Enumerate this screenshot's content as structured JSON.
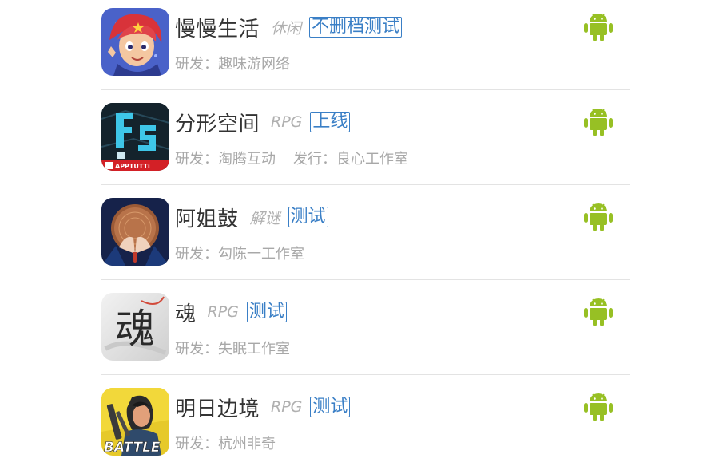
{
  "theme": {
    "android_green": "#97c024",
    "tag_blue": "#3a7fc6",
    "divider": "#e3e3e3"
  },
  "games": [
    {
      "name": "慢慢生活",
      "genre": "休闲",
      "status": "不删档测试",
      "developer": "研发：趣味游网络",
      "publisher": "",
      "icon": "cartoon-girl-icon",
      "platform_icon": "android-icon"
    },
    {
      "name": "分形空间",
      "genre": "RPG",
      "status": "上线",
      "developer": "研发：淘腾互动",
      "publisher": "发行：良心工作室",
      "icon": "fs-logo-icon",
      "icon_caption": "APPTUTTi",
      "platform_icon": "android-icon"
    },
    {
      "name": "阿姐鼓",
      "genre": "解谜",
      "status": "测试",
      "developer": "研发：勾陈一工作室",
      "publisher": "",
      "icon": "drum-hands-icon",
      "platform_icon": "android-icon"
    },
    {
      "name": "魂",
      "genre": "RPG",
      "status": "测试",
      "developer": "研发：失眠工作室",
      "publisher": "",
      "icon": "soul-calligraphy-icon",
      "icon_glyph": "魂",
      "platform_icon": "android-icon"
    },
    {
      "name": "明日边境",
      "genre": "RPG",
      "status": "测试",
      "developer": "研发：杭州非奇",
      "publisher": "",
      "icon": "battle-soldier-icon",
      "icon_caption": "BATTLE",
      "platform_icon": "android-icon"
    }
  ]
}
